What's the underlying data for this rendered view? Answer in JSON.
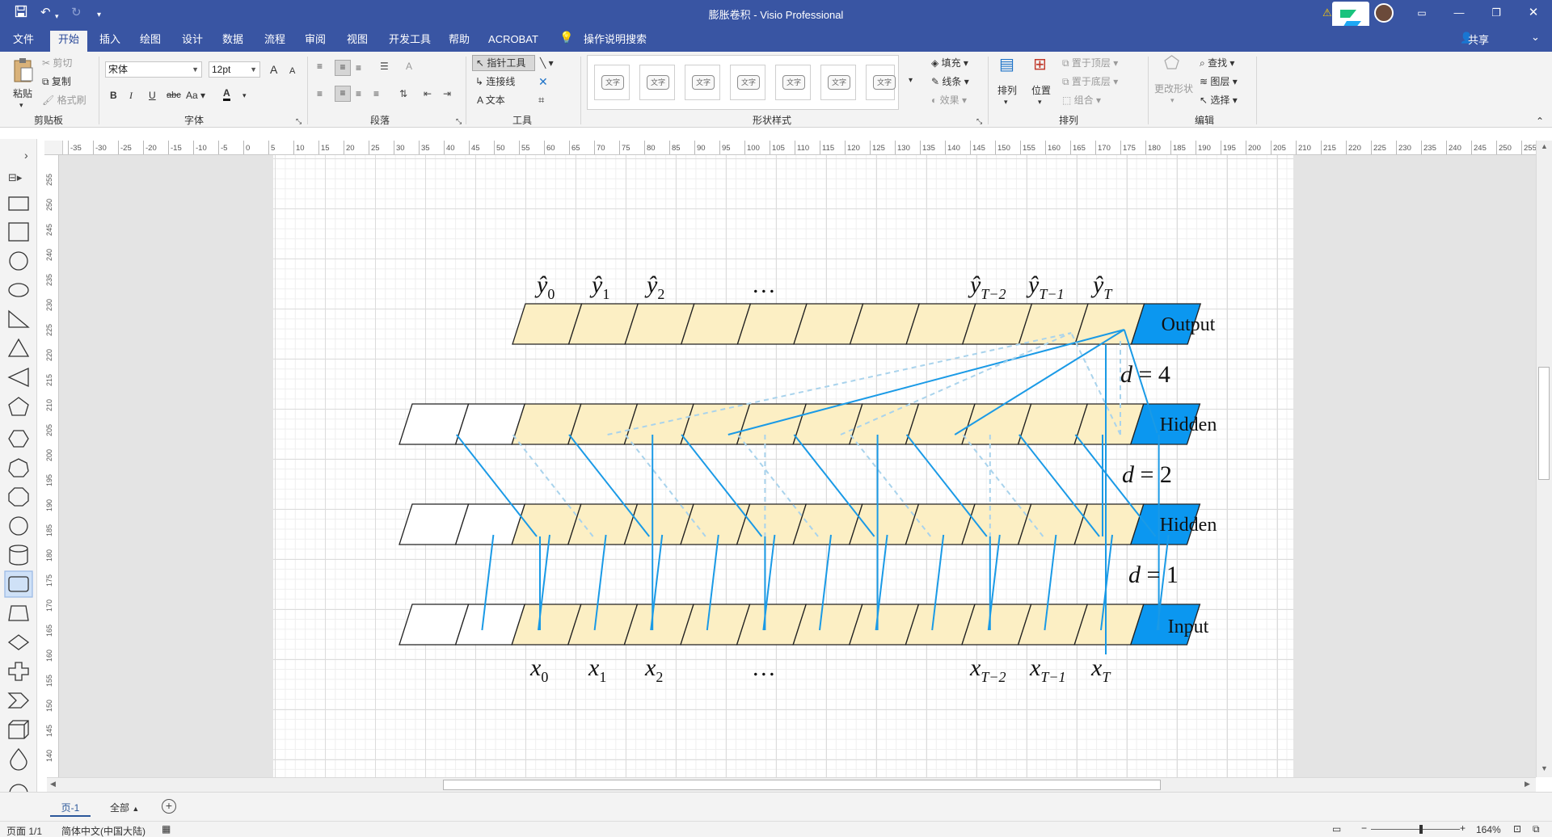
{
  "app": {
    "doc_title": "膨胀卷积  -  Visio Professional",
    "share_label": "共享"
  },
  "tabs": [
    "文件",
    "开始",
    "插入",
    "绘图",
    "设计",
    "数据",
    "流程",
    "审阅",
    "视图",
    "开发工具",
    "帮助",
    "ACROBAT"
  ],
  "tell_me": "操作说明搜索",
  "ribbon": {
    "clipboard": {
      "paste": "粘贴",
      "cut": "剪切",
      "copy": "复制",
      "format_painter": "格式刷",
      "label": "剪贴板"
    },
    "font": {
      "family": "宋体",
      "size": "12pt",
      "bold": "B",
      "italic": "I",
      "underline": "U",
      "strike": "abc",
      "case": "Aa",
      "color_icon": "A",
      "grow": "A",
      "shrink": "A",
      "label": "字体"
    },
    "paragraph": {
      "label": "段落"
    },
    "tools": {
      "pointer": "指针工具",
      "connector": "连接线",
      "text": "文本",
      "label": "工具"
    },
    "shape_styles": {
      "swatch": "文字",
      "fill": "填充",
      "line": "线条",
      "effects": "效果",
      "label": "形状样式"
    },
    "arrange": {
      "arrange": "排列",
      "position": "位置",
      "bring_front": "置于顶层",
      "send_back": "置于底层",
      "group": "组合",
      "label": "排列"
    },
    "editing": {
      "change_shape": "更改形状",
      "find": "查找",
      "layers": "图层",
      "select": "选择",
      "label": "编辑"
    }
  },
  "ruler": {
    "h": [
      "-35",
      "-30",
      "-25",
      "-20",
      "-15",
      "-10",
      "-5",
      "0",
      "5",
      "10",
      "15",
      "20",
      "25",
      "30",
      "35",
      "40",
      "45",
      "50",
      "55",
      "60",
      "65",
      "70",
      "75",
      "80",
      "85",
      "90",
      "95",
      "100",
      "105",
      "110",
      "115",
      "120",
      "125",
      "130",
      "135",
      "140",
      "145",
      "150",
      "155",
      "160",
      "165",
      "170",
      "175",
      "180",
      "185",
      "190",
      "195",
      "200",
      "205",
      "210",
      "215",
      "220",
      "225",
      "230",
      "235",
      "240",
      "245",
      "250",
      "255"
    ],
    "v": [
      "255",
      "250",
      "245",
      "240",
      "235",
      "230",
      "225",
      "220",
      "215",
      "210",
      "205",
      "200",
      "195",
      "190",
      "185",
      "180",
      "175",
      "170",
      "165",
      "160",
      "155",
      "150",
      "145",
      "140"
    ]
  },
  "diagram": {
    "output_labels": [
      {
        "base": "ŷ",
        "sub": "0"
      },
      {
        "base": "ŷ",
        "sub": "1"
      },
      {
        "base": "ŷ",
        "sub": "2"
      },
      {
        "base": "…",
        "sub": ""
      },
      {
        "base": "ŷ",
        "sub": "T−2"
      },
      {
        "base": "ŷ",
        "sub": "T−1"
      },
      {
        "base": "ŷ",
        "sub": "T"
      }
    ],
    "input_labels": [
      {
        "base": "x",
        "sub": "0"
      },
      {
        "base": "x",
        "sub": "1"
      },
      {
        "base": "x",
        "sub": "2"
      },
      {
        "base": "…",
        "sub": ""
      },
      {
        "base": "x",
        "sub": "T−2"
      },
      {
        "base": "x",
        "sub": "T−1"
      },
      {
        "base": "x",
        "sub": "T"
      }
    ],
    "row_labels": [
      "Output",
      "Hidden",
      "Hidden",
      "Input"
    ],
    "dilations": [
      {
        "var": "d",
        "eq": " = ",
        "val": "4"
      },
      {
        "var": "d",
        "eq": " = ",
        "val": "2"
      },
      {
        "var": "d",
        "eq": " = ",
        "val": "1"
      }
    ],
    "colors": {
      "cell": "#fcefc4",
      "padding": "#ffffff",
      "current": "#0b97f0",
      "line": "#1a9ae6",
      "dashed": "#a9d3ec"
    }
  },
  "page_tabs": {
    "page": "页-1",
    "all": "全部"
  },
  "status": {
    "page_info": "页面 1/1",
    "language": "简体中文(中国大陆)",
    "zoom": "164%"
  }
}
